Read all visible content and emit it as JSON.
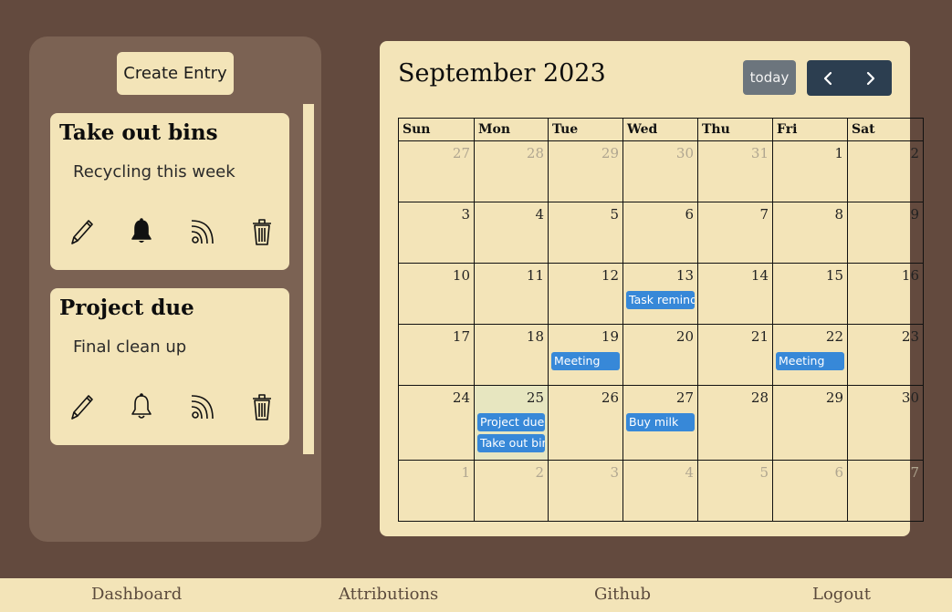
{
  "sidebar": {
    "create_label": "Create Entry",
    "entries": [
      {
        "title": "Take out bins",
        "description": "Recycling this week",
        "reminder": "bell-filled"
      },
      {
        "title": "Project due",
        "description": "Final clean up",
        "reminder": "bell-outline"
      }
    ]
  },
  "calendar": {
    "title": "September 2023",
    "today_label": "today",
    "weekdays": [
      "Sun",
      "Mon",
      "Tue",
      "Wed",
      "Thu",
      "Fri",
      "Sat"
    ],
    "weeks": [
      [
        {
          "d": "27",
          "other": true
        },
        {
          "d": "28",
          "other": true
        },
        {
          "d": "29",
          "other": true
        },
        {
          "d": "30",
          "other": true
        },
        {
          "d": "31",
          "other": true
        },
        {
          "d": "1"
        },
        {
          "d": "2"
        }
      ],
      [
        {
          "d": "3"
        },
        {
          "d": "4"
        },
        {
          "d": "5"
        },
        {
          "d": "6"
        },
        {
          "d": "7"
        },
        {
          "d": "8"
        },
        {
          "d": "9"
        }
      ],
      [
        {
          "d": "10"
        },
        {
          "d": "11"
        },
        {
          "d": "12"
        },
        {
          "d": "13",
          "events": [
            "Task reminder"
          ]
        },
        {
          "d": "14"
        },
        {
          "d": "15"
        },
        {
          "d": "16"
        }
      ],
      [
        {
          "d": "17"
        },
        {
          "d": "18"
        },
        {
          "d": "19",
          "events": [
            "Meeting"
          ]
        },
        {
          "d": "20"
        },
        {
          "d": "21"
        },
        {
          "d": "22",
          "events": [
            "Meeting"
          ]
        },
        {
          "d": "23"
        }
      ],
      [
        {
          "d": "24"
        },
        {
          "d": "25",
          "today": true,
          "events": [
            "Project due",
            "Take out bins"
          ]
        },
        {
          "d": "26"
        },
        {
          "d": "27",
          "events": [
            "Buy milk"
          ]
        },
        {
          "d": "28"
        },
        {
          "d": "29"
        },
        {
          "d": "30"
        }
      ],
      [
        {
          "d": "1",
          "other": true
        },
        {
          "d": "2",
          "other": true
        },
        {
          "d": "3",
          "other": true
        },
        {
          "d": "4",
          "other": true
        },
        {
          "d": "5",
          "other": true
        },
        {
          "d": "6",
          "other": true
        },
        {
          "d": "7",
          "other": true
        }
      ]
    ]
  },
  "footer": {
    "links": [
      "Dashboard",
      "Attributions",
      "Github",
      "Logout"
    ]
  },
  "colors": {
    "background": "#634a3e",
    "panel": "#f3e4b8",
    "sidebar": "#7b6253",
    "event": "#3788d8",
    "nav": "#2c3e50",
    "today_button": "#6c757d"
  }
}
